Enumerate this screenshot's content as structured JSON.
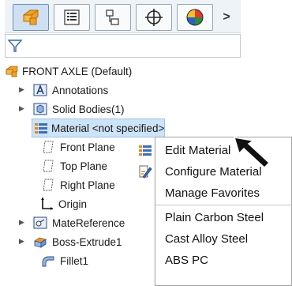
{
  "toolbar": {
    "buttons": [
      {
        "name": "feature-manager-tab-icon",
        "active": true
      },
      {
        "name": "property-manager-tab-icon",
        "active": false
      },
      {
        "name": "configuration-manager-tab-icon",
        "active": false
      },
      {
        "name": "dimxpert-manager-tab-icon",
        "active": false
      },
      {
        "name": "display-manager-tab-icon",
        "active": false
      }
    ],
    "more_arrow": ">"
  },
  "tree": {
    "root": "FRONT AXLE  (Default)",
    "items": [
      {
        "label": "Annotations",
        "icon": "annotations-icon",
        "expandable": true
      },
      {
        "label": "Solid Bodies(1)",
        "icon": "solid-bodies-icon",
        "expandable": true
      },
      {
        "label": "Material <not specified>",
        "icon": "material-icon",
        "expandable": false,
        "selected": true
      },
      {
        "label": "Front Plane",
        "icon": "plane-icon",
        "expandable": false
      },
      {
        "label": "Top Plane",
        "icon": "plane-icon",
        "expandable": false
      },
      {
        "label": "Right Plane",
        "icon": "plane-icon",
        "expandable": false
      },
      {
        "label": "Origin",
        "icon": "origin-icon",
        "expandable": false
      },
      {
        "label": "MateReference",
        "icon": "mate-reference-icon",
        "expandable": true
      },
      {
        "label": "Boss-Extrude1",
        "icon": "boss-extrude-icon",
        "expandable": true
      },
      {
        "label": "Fillet1",
        "icon": "fillet-icon",
        "expandable": false
      }
    ]
  },
  "context_menu": {
    "items": [
      {
        "label": "Edit Material",
        "icon": "edit-material-icon"
      },
      {
        "label": "Configure Material",
        "icon": "configure-material-icon"
      },
      {
        "label": "Manage Favorites",
        "icon": ""
      },
      {
        "label": "Plain Carbon Steel",
        "icon": ""
      },
      {
        "label": "Cast Alloy Steel",
        "icon": ""
      },
      {
        "label": "ABS PC",
        "icon": ""
      }
    ]
  }
}
